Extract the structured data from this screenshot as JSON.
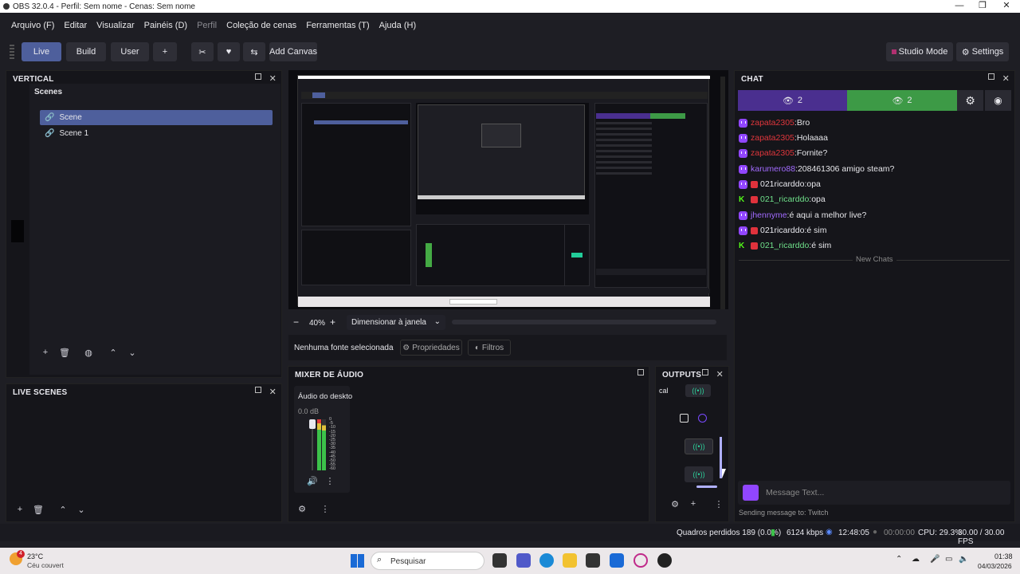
{
  "window": {
    "title": "OBS 32.0.4 - Perfil: Sem nome - Cenas: Sem nome",
    "minimize": "—",
    "maximize": "❐",
    "close": "✕"
  },
  "menu": [
    "Arquivo (F)",
    "Editar",
    "Visualizar",
    "Painéis (D)",
    "Perfil",
    "Coleção de cenas",
    "Ferramentas (T)",
    "Ajuda (H)"
  ],
  "toolbar": {
    "live": "Live",
    "build": "Build",
    "user": "User",
    "plus": "+",
    "add_canvas": "Add Canvas",
    "studio_mode": "Studio Mode",
    "settings": "Settings"
  },
  "vertical": {
    "title": "VERTICAL",
    "scenes_label": "Scenes",
    "scenes": [
      "Scene",
      "Scene 1"
    ]
  },
  "live_scenes": {
    "title": "LIVE SCENES"
  },
  "preview": {
    "zoom": "40%",
    "minus": "−",
    "plus": "+",
    "scale_mode": "Dimensionar à janela",
    "no_source": "Nenhuma fonte selecionada",
    "properties": "Propriedades",
    "filters": "Filtros"
  },
  "mixer": {
    "title": "MIXER DE ÁUDIO",
    "channel_name": "Áudio do deskto",
    "level": "0.0 dB",
    "ticks": [
      "0",
      "-5",
      "-10",
      "-15",
      "-20",
      "-25",
      "-30",
      "-35",
      "-40",
      "-45",
      "-50",
      "-55",
      "-60"
    ]
  },
  "outputs": {
    "title": "OUTPUTS",
    "cut_label": "cal"
  },
  "chat": {
    "title": "CHAT",
    "twitch_viewers": "2",
    "kick_viewers": "2",
    "messages": [
      {
        "platform": "twitch",
        "user": "zapata2305",
        "user_color": "red",
        "badge": false,
        "text": "Bro"
      },
      {
        "platform": "twitch",
        "user": "zapata2305",
        "user_color": "red",
        "badge": false,
        "text": "Holaaaa"
      },
      {
        "platform": "twitch",
        "user": "zapata2305",
        "user_color": "red",
        "badge": false,
        "text": "Fornite?"
      },
      {
        "platform": "twitch",
        "user": "karumero88",
        "user_color": "purple",
        "badge": false,
        "text": "208461306 amigo steam?"
      },
      {
        "platform": "twitch",
        "user": "021ricarddo",
        "user_color": "white",
        "badge": true,
        "text": "opa"
      },
      {
        "platform": "kick",
        "user": "021_ricarddo",
        "user_color": "green",
        "badge": true,
        "text": "opa"
      },
      {
        "platform": "twitch",
        "user": "jhennyme",
        "user_color": "purple",
        "badge": false,
        "text": "é aqui a melhor live?"
      },
      {
        "platform": "twitch",
        "user": "021ricarddo",
        "user_color": "white",
        "badge": true,
        "text": "é sim"
      },
      {
        "platform": "kick",
        "user": "021_ricarddo",
        "user_color": "green",
        "badge": true,
        "text": "é sim"
      }
    ],
    "separator": "New Chats",
    "input_placeholder": "Message Text...",
    "sending_to": "Sending message to: Twitch"
  },
  "status": {
    "dropped": "Quadros perdidos 189 (0.0%)",
    "bitrate": "6124 kbps",
    "stream_time": "12:48:05",
    "rec_time": "00:00:00",
    "cpu": "CPU: 29.3%",
    "fps": "30.00 / 30.00 FPS"
  },
  "taskbar": {
    "notif_count": "4",
    "temp": "23°C",
    "weather": "Céu couvert",
    "search": "Pesquisar",
    "time": "01:38",
    "date": "04/03/2026"
  },
  "colors": {
    "accent": "#4e5f9c",
    "twitch": "#9146ff",
    "kick": "#53fc18",
    "twitch_bar": "#4a2f8f",
    "kick_bar": "#3d9a46"
  }
}
